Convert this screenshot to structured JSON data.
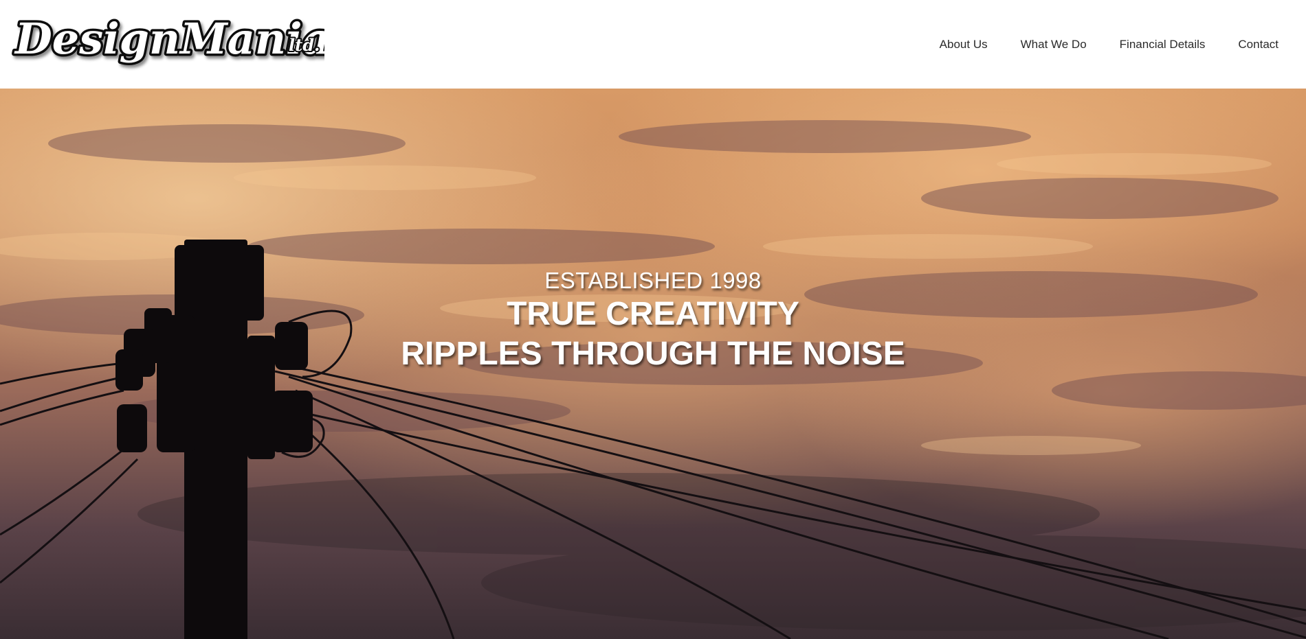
{
  "header": {
    "logo": {
      "name": "DesignMania",
      "suffix": "ltd."
    },
    "nav": [
      {
        "label": "About Us"
      },
      {
        "label": "What We Do"
      },
      {
        "label": "Financial Details"
      },
      {
        "label": "Contact"
      }
    ]
  },
  "hero": {
    "eyebrow": "ESTABLISHED 1998",
    "headline_line1": "TRUE CREATIVITY",
    "headline_line2": "RIPPLES THROUGH THE NOISE"
  },
  "colors": {
    "header_bg": "#ffffff",
    "nav_text": "#2a2a2a",
    "hero_text": "#ffffff",
    "sky_top": "#e9a76a",
    "sky_bottom": "#3a2d33"
  }
}
